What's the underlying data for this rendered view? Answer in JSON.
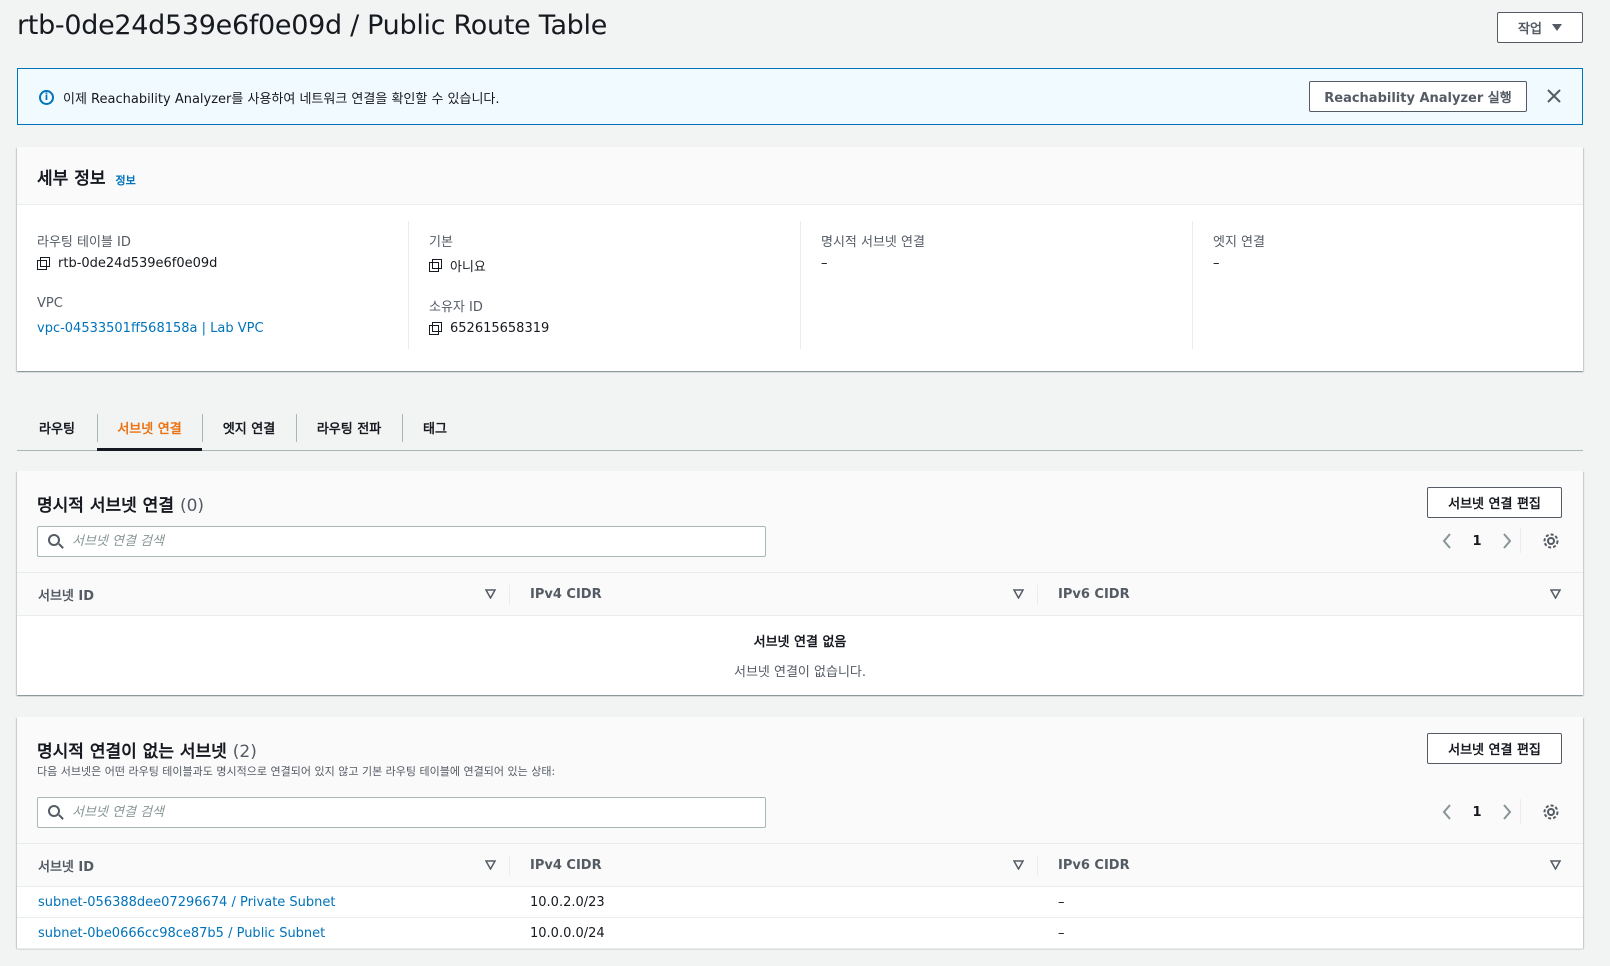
{
  "header": {
    "title": "rtb-0de24d539e6f0e09d / Public Route Table",
    "actions_label": "작업"
  },
  "flash": {
    "message": "이제 Reachability Analyzer를 사용하여 네트워크 연결을 확인할 수 있습니다.",
    "button_label": "Reachability Analyzer 실행"
  },
  "details": {
    "title": "세부 정보",
    "info_link": "정보",
    "route_table_id_label": "라우팅 테이블 ID",
    "route_table_id": "rtb-0de24d539e6f0e09d",
    "vpc_label": "VPC",
    "vpc": "vpc-04533501ff568158a | Lab VPC",
    "main_label": "기본",
    "main": "아니요",
    "owner_label": "소유자 ID",
    "owner": "652615658319",
    "explicit_subnet_label": "명시적 서브넷 연결",
    "explicit_subnet": "–",
    "edge_label": "엣지 연결",
    "edge": "–"
  },
  "tabs": [
    "라우팅",
    "서브넷 연결",
    "엣지 연결",
    "라우팅 전파",
    "태그"
  ],
  "active_tab": "서브넷 연결",
  "explicit_section": {
    "title": "명시적 서브넷 연결",
    "count": "(0)",
    "edit_label": "서브넷 연결 편집",
    "search_placeholder": "서브넷 연결 검색",
    "page": "1",
    "columns": [
      "서브넷 ID",
      "IPv4 CIDR",
      "IPv6 CIDR"
    ],
    "empty_title": "서브넷 연결 없음",
    "empty_desc": "서브넷 연결이 없습니다."
  },
  "implicit_section": {
    "title": "명시적 연결이 없는 서브넷",
    "count": "(2)",
    "description": "다음 서브넷은 어떤 라우팅 테이블과도 명시적으로 연결되어 있지 않고 기본 라우팅 테이블에 연결되어 있는 상태:",
    "edit_label": "서브넷 연결 편집",
    "search_placeholder": "서브넷 연결 검색",
    "page": "1",
    "columns": [
      "서브넷 ID",
      "IPv4 CIDR",
      "IPv6 CIDR"
    ],
    "rows": [
      {
        "subnet": "subnet-056388dee07296674 / Private Subnet",
        "ipv4": "10.0.2.0/23",
        "ipv6": "–"
      },
      {
        "subnet": "subnet-0be0666cc98ce87b5 / Public Subnet",
        "ipv4": "10.0.0.0/24",
        "ipv6": "–"
      }
    ]
  },
  "colors": {
    "link": "#0073bb",
    "active_tab": "#ec7211",
    "info_border": "#0073bb",
    "info_bg": "#f1faff"
  }
}
